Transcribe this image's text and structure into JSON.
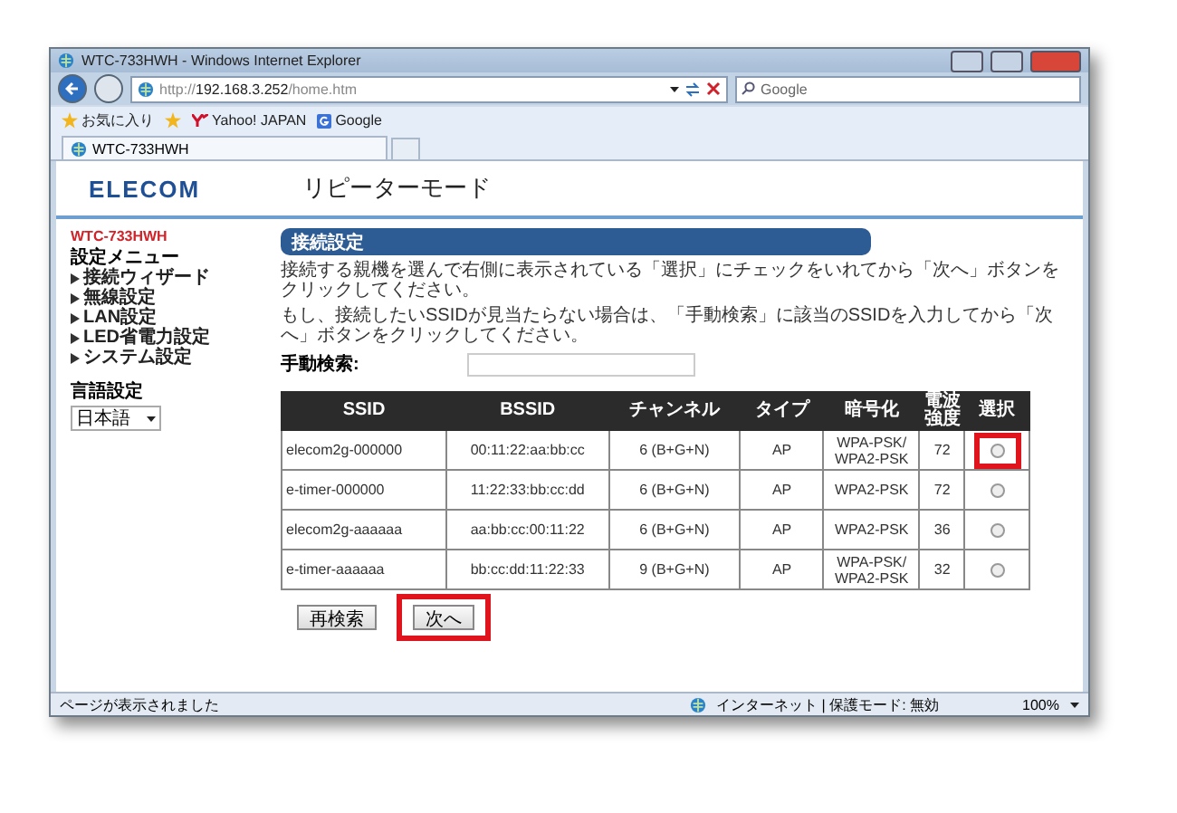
{
  "window": {
    "title": "WTC-733HWH - Windows Internet Explorer"
  },
  "address_bar": {
    "url": "http://**192.168.3.252**/home.htm"
  },
  "search": {
    "placeholder": "Google"
  },
  "favorites_bar": {
    "favorites": "お気に入り",
    "links": [
      {
        "label": "Yahoo! JAPAN",
        "kind": "yahoo"
      },
      {
        "label": "Google",
        "kind": "google"
      }
    ]
  },
  "tabs": [
    {
      "label": "WTC-733HWH",
      "selected": true
    }
  ],
  "header": {
    "logo": "ELECOM",
    "title": "リピーターモード"
  },
  "sidebar": {
    "device": "WTC-733HWH",
    "menu_title": "設定メニュー",
    "items": [
      "接続ウィザード",
      "無線設定",
      "LAN設定",
      "LED省電力設定",
      "システム設定"
    ],
    "language_label": "言語設定",
    "language": "日本語"
  },
  "section": {
    "title": "接続設定",
    "paragraphs": [
      "接続する親機を選んで右側に表示されている「選択」にチェックをいれてから「次へ」ボタンをクリックしてください。",
      "もし、接続したいSSIDが見当たらない場合は、「手動検索」に該当のSSIDを入力してから「次へ」ボタンをクリックしてください。"
    ],
    "manual_search_label": "手動検索:"
  },
  "table": {
    "columns": [
      "SSID",
      "BSSID",
      "チャンネル",
      "タイプ",
      "暗号化",
      "電波強度",
      "選択"
    ],
    "rows": [
      {
        "cells": [
          "elecom2g-000000",
          "00:11:22:aa:bb:cc",
          "6 (B+G+N)",
          "AP",
          "WPA-PSK/ WPA2-PSK",
          "72"
        ],
        "selected": false,
        "highlighted": true
      },
      {
        "cells": [
          "e-timer-000000",
          "11:22:33:bb:cc:dd",
          "6 (B+G+N)",
          "AP",
          "WPA2-PSK",
          "72"
        ],
        "selected": false,
        "highlighted": false
      },
      {
        "cells": [
          "elecom2g-aaaaaa",
          "aa:bb:cc:00:11:22",
          "6 (B+G+N)",
          "AP",
          "WPA2-PSK",
          "36"
        ],
        "selected": false,
        "highlighted": false
      },
      {
        "cells": [
          "e-timer-aaaaaa",
          "bb:cc:dd:11:22:33",
          "9 (B+G+N)",
          "AP",
          "WPA-PSK/ WPA2-PSK",
          "32"
        ],
        "selected": false,
        "highlighted": false
      }
    ]
  },
  "buttons": [
    {
      "label": "再検索",
      "highlighted": false
    },
    {
      "label": "次へ",
      "highlighted": true
    }
  ],
  "status_bar": {
    "message": "ページが表示されました",
    "zone": "インターネット | 保護モード: 無効",
    "zoom": "100%"
  }
}
